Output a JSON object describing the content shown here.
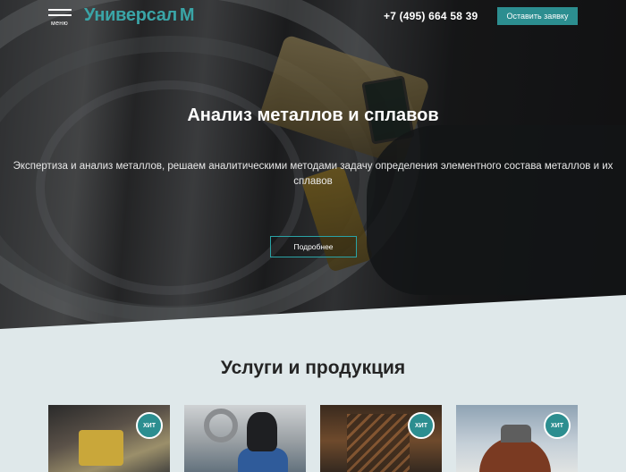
{
  "header": {
    "menu_label": "меню",
    "logo_text": "Универсал",
    "logo_mark": "M",
    "phone": "+7 (495) 664 58 39",
    "cta_label": "Оставить заявку"
  },
  "hero": {
    "title": "Анализ металлов и сплавов",
    "subtitle": "Экспертиза и анализ металлов, решаем аналитическими методами задачу определения элементного состава металлов и их сплавов",
    "more_label": "Подробнее"
  },
  "services": {
    "title": "Услуги и продукция",
    "cards": [
      {
        "badge": "ХИТ"
      },
      {
        "badge": ""
      },
      {
        "badge": "ХИТ"
      },
      {
        "badge": "ХИТ"
      }
    ]
  },
  "colors": {
    "accent": "#2c8e90",
    "logo": "#3aa5a7",
    "section_bg": "#dfe8ea"
  }
}
